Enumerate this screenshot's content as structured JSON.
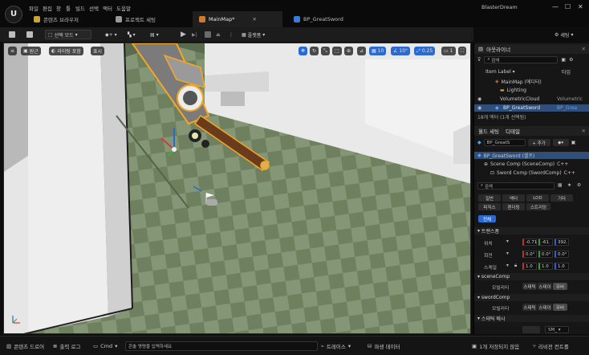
{
  "window": {
    "project_name": "BlasterDream",
    "menu": [
      "파일",
      "편집",
      "창",
      "툴",
      "빌드",
      "선택",
      "액터",
      "도움말"
    ],
    "tabs": [
      {
        "label": "콘텐츠 브라우저"
      },
      {
        "label": "프로젝트 세팅"
      },
      {
        "label": "MainMap*"
      },
      {
        "label": "BP_GreatSword"
      }
    ]
  },
  "toolbar": {
    "mode": "선택 모드",
    "platforms": "플랫폼",
    "settings": "세팅"
  },
  "viewport": {
    "perspective": "원근",
    "lit": "라이팅 포함",
    "show": "표시",
    "grid_snap": "10",
    "rot_snap": "10°",
    "scale_snap": "0.25",
    "cam_speed": "1"
  },
  "outliner": {
    "title": "아웃라이너",
    "search_placeholder": "검색",
    "col_label": "Item Label ▾",
    "col_type": "타입",
    "items": [
      {
        "label": "MainMap (에디터)",
        "type": ""
      },
      {
        "label": "Lighting",
        "type": ""
      },
      {
        "label": "VolumetricCloud",
        "type": "Volumetric"
      },
      {
        "label": "BP_GreatSword",
        "type": "BP_Grea"
      }
    ],
    "footer": "18개 액터 (1개 선택됨)"
  },
  "details": {
    "tab_details": "디테일",
    "tab_world": "월드 세팅",
    "actor_name": "BP_GreatS",
    "add_button": "+ 추가",
    "components": [
      {
        "label": "BP_GreatSword (셀프)"
      },
      {
        "label": "Scene Comp (SceneComp)",
        "suffix": "C++"
      },
      {
        "label": "Sword Comp (SwordComp)",
        "suffix": "C++"
      }
    ],
    "search_placeholder": "검색",
    "filter_tabs": [
      "일반",
      "액터",
      "LOD",
      "기타",
      "피직스",
      "렌더링",
      "스트리밍",
      "전체"
    ],
    "transform_header": "트랜스폼",
    "location_label": "위치",
    "location_values": [
      "-0.71",
      "-61.",
      "392."
    ],
    "rotation_label": "회전",
    "rotation_values": [
      "0.0°",
      "0.0°",
      "0.0°"
    ],
    "scale_label": "스케일",
    "scale_values": [
      "1.0",
      "1.0",
      "1.0"
    ],
    "scenecomp_header": "sceneComp",
    "scenecomp_label": "모빌리티",
    "mobility_options": [
      "스태틱",
      "스테이",
      "무버"
    ],
    "swordcomp_header": "swordComp",
    "swordcomp_label": "모빌리티",
    "static_mesh_header": "스태틱 메시",
    "static_mesh_value": "SM_"
  },
  "statusbar": {
    "content_drawer": "콘텐츠 드로어",
    "output_log": "출력 로그",
    "cmd": "Cmd",
    "console_placeholder": "콘솔 명령을 입력하세요",
    "trace": "트레이스",
    "derived_data": "파생 데이터",
    "unsaved": "1개 저장되지 않음",
    "source_control": "리비전 컨트롤"
  },
  "colors": {
    "accent_blue": "#2a6ad1",
    "selection_orange": "#f5a623",
    "floor_green": "#6f805f"
  }
}
